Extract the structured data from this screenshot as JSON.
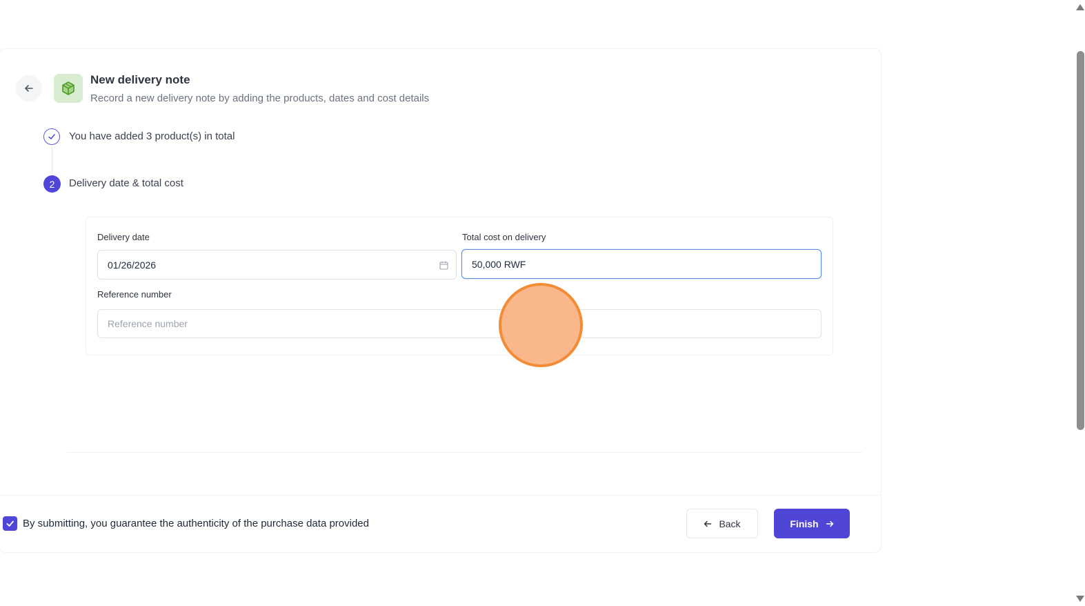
{
  "header": {
    "title": "New delivery note",
    "subtitle": "Record a new delivery note by adding the products, dates and cost details",
    "back_icon": "arrow-left-icon",
    "title_icon": "package-icon"
  },
  "steps": [
    {
      "status": "done",
      "text": "You have added 3 product(s) in total",
      "icon": "check-icon"
    },
    {
      "status": "active",
      "number": "2",
      "text": "Delivery date & total cost"
    }
  ],
  "form": {
    "delivery_date": {
      "label": "Delivery date",
      "value": "01/26/2026",
      "icon": "calendar-icon"
    },
    "total_cost": {
      "label": "Total cost on delivery",
      "value": "50,000 RWF"
    },
    "reference": {
      "label": "Reference number",
      "placeholder": "Reference number",
      "value": ""
    }
  },
  "footer": {
    "consent_checked": true,
    "consent_text": "By submitting, you guarantee the authenticity of the purchase data provided",
    "back_label": "Back",
    "finish_label": "Finish"
  },
  "colors": {
    "primary": "#4f46d8",
    "icon_bg": "#d7ecd0",
    "icon_green": "#6db33f",
    "focus_border": "#5b8fd9"
  }
}
